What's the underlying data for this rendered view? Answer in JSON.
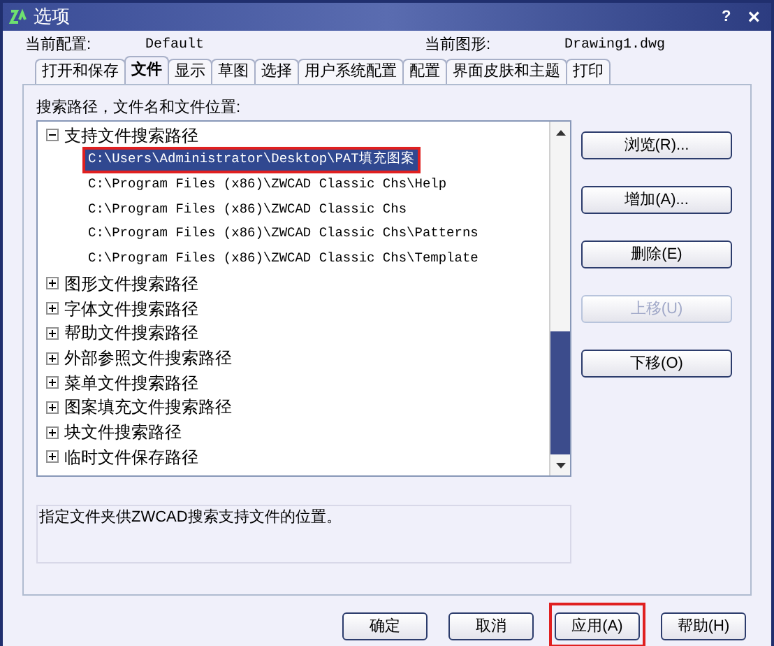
{
  "window": {
    "title": "选项",
    "help": "?",
    "close": "×"
  },
  "header": {
    "profile_label": "当前配置:",
    "profile": "Default",
    "drawing_label": "当前图形:",
    "drawing": "Drawing1.dwg"
  },
  "tabs": [
    {
      "label": "打开和保存",
      "selected": false
    },
    {
      "label": "文件",
      "selected": true
    },
    {
      "label": "显示",
      "selected": false
    },
    {
      "label": "草图",
      "selected": false
    },
    {
      "label": "选择",
      "selected": false
    },
    {
      "label": "用户系统配置",
      "selected": false
    },
    {
      "label": "配置",
      "selected": false
    },
    {
      "label": "界面皮肤和主题",
      "selected": false
    },
    {
      "label": "打印",
      "selected": false
    }
  ],
  "tree_label": "搜索路径，文件名和文件位置:",
  "tree": [
    {
      "label": "支持文件搜索路径",
      "expanded": true,
      "children": [
        {
          "label": "C:\\Users\\Administrator\\Desktop\\PAT填充图案",
          "selected": true,
          "annotated": true
        },
        {
          "label": "C:\\Program Files (x86)\\ZWCAD Classic Chs\\Help",
          "selected": false,
          "annotated": false
        },
        {
          "label": "C:\\Program Files (x86)\\ZWCAD Classic Chs",
          "selected": false,
          "annotated": false
        },
        {
          "label": "C:\\Program Files (x86)\\ZWCAD Classic Chs\\Patterns",
          "selected": false,
          "annotated": false
        },
        {
          "label": "C:\\Program Files (x86)\\ZWCAD Classic Chs\\Template",
          "selected": false,
          "annotated": false
        }
      ]
    },
    {
      "label": "图形文件搜索路径",
      "expanded": false
    },
    {
      "label": "字体文件搜索路径",
      "expanded": false
    },
    {
      "label": "帮助文件搜索路径",
      "expanded": false
    },
    {
      "label": "外部参照文件搜索路径",
      "expanded": false
    },
    {
      "label": "菜单文件搜索路径",
      "expanded": false
    },
    {
      "label": "图案填充文件搜索路径",
      "expanded": false
    },
    {
      "label": "块文件搜索路径",
      "expanded": false
    },
    {
      "label": "临时文件保存路径",
      "expanded": false
    }
  ],
  "side_buttons": [
    {
      "label": "浏览(R)...",
      "disabled": false
    },
    {
      "label": "增加(A)...",
      "disabled": false
    },
    {
      "label": "删除(E)",
      "disabled": false
    },
    {
      "label": "上移(U)",
      "disabled": true
    },
    {
      "label": "下移(O)",
      "disabled": false
    }
  ],
  "description": "指定文件夹供ZWCAD搜索支持文件的位置。",
  "footer_buttons": [
    {
      "label": "确定",
      "annotated": false
    },
    {
      "label": "取消",
      "annotated": false
    },
    {
      "label": "应用(A)",
      "annotated": true
    },
    {
      "label": "帮助(H)",
      "annotated": false
    }
  ]
}
